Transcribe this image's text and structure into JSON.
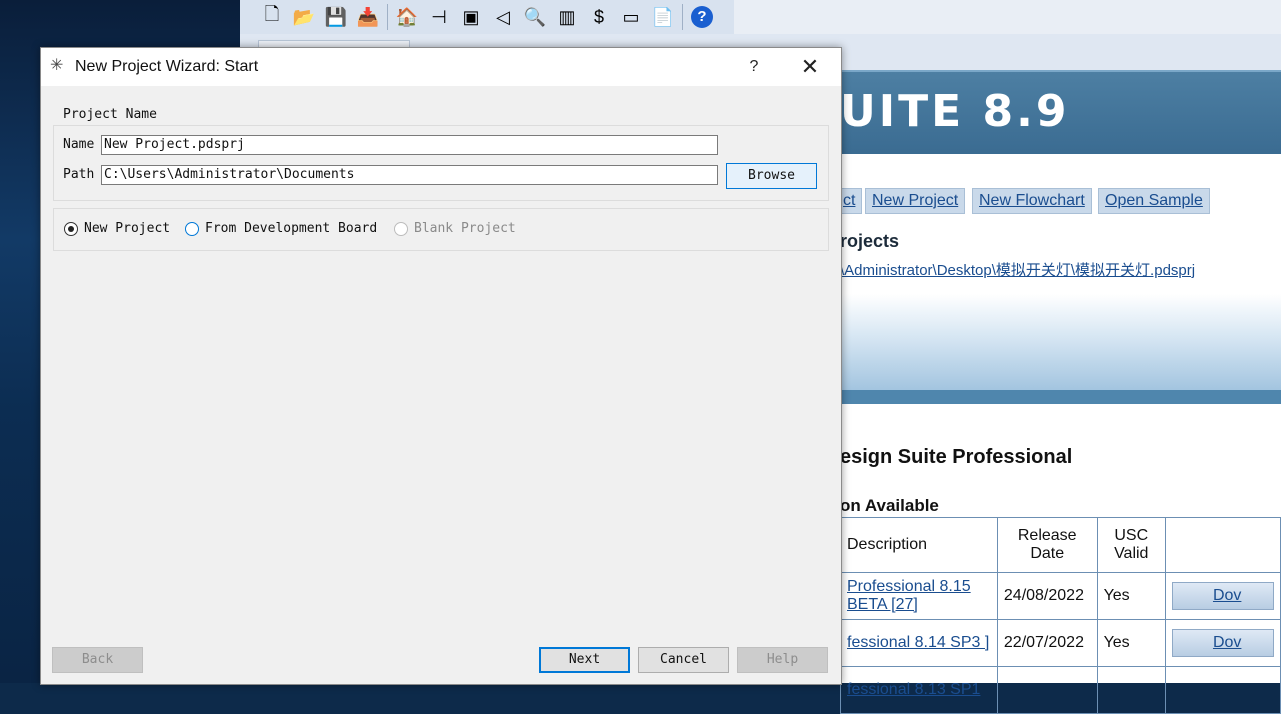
{
  "dialog": {
    "title": "New Project Wizard: Start",
    "help_glyph": "?",
    "close_glyph": "✕",
    "group_title": "Project Name",
    "name_label": "Name",
    "name_value": "New Project.pdsprj",
    "path_label": "Path",
    "path_value": "C:\\Users\\Administrator\\Documents",
    "browse_label": "Browse",
    "radio_options": [
      {
        "label": "New Project",
        "selected": true,
        "enabled": true
      },
      {
        "label": "From Development Board",
        "selected": false,
        "enabled": true
      },
      {
        "label": "Blank Project",
        "selected": false,
        "enabled": false
      }
    ],
    "buttons": {
      "back": "Back",
      "next": "Next",
      "cancel": "Cancel",
      "help": "Help"
    }
  },
  "background_app": {
    "banner_text": "UITE 8.9",
    "links": [
      "ct",
      "New Project",
      "New Flowchart",
      "Open Sample"
    ],
    "recent_projects_title": "rojects",
    "recent_project_path": "\\Administrator\\Desktop\\模拟开关灯\\模拟开关灯.pdsprj",
    "news_title": "esign Suite Professional",
    "update_title": "on Available",
    "table": {
      "headers": [
        "Description",
        "Release Date",
        "USC Valid",
        ""
      ],
      "rows": [
        {
          "description": "Professional 8.15 BETA [27]",
          "date": "24/08/2022",
          "usc": "Yes",
          "action": "Dov"
        },
        {
          "description": "fessional 8.14 SP3 ]",
          "date": "22/07/2022",
          "usc": "Yes",
          "action": "Dov"
        },
        {
          "description": "fessional 8.13 SP1",
          "date": "",
          "usc": "",
          "action": ""
        }
      ]
    }
  },
  "colors": {
    "accent": "#0078d7",
    "banner": "#3a6b91",
    "link": "#1a4d8f"
  }
}
